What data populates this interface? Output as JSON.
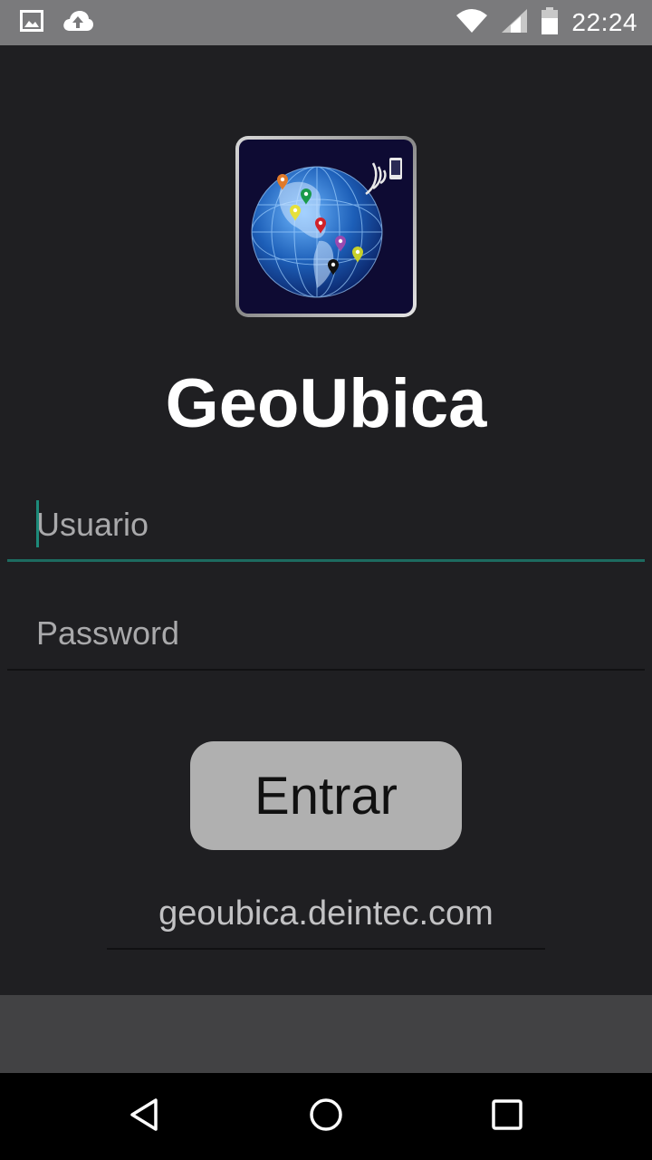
{
  "status_bar": {
    "time": "22:24",
    "icons": [
      "image-icon",
      "cloud-upload-icon",
      "wifi-icon",
      "cell-signal-icon",
      "battery-icon"
    ]
  },
  "app": {
    "title": "GeoUbica",
    "logo_icon": "globe-map-pins-logo"
  },
  "form": {
    "username_placeholder": "Usuario",
    "password_placeholder": "Password",
    "login_label": "Entrar",
    "server_value": "geoubica.deintec.com"
  },
  "nav": {
    "icons": [
      "back-icon",
      "home-icon",
      "recents-icon"
    ]
  },
  "colors": {
    "background": "#1f1f22",
    "status_bar": "#7a7a7c",
    "accent": "#1d6b60",
    "button": "#b0b0b0",
    "bottom_strip": "#424244",
    "nav_bar": "#000000"
  }
}
